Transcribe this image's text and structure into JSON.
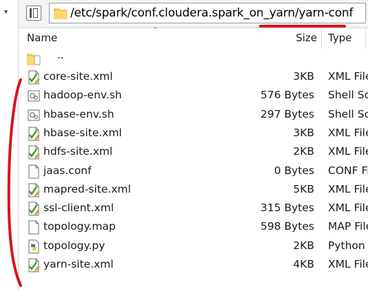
{
  "address_bar": {
    "path": "/etc/spark/conf.cloudera.spark_on_yarn/yarn-conf"
  },
  "columns": {
    "name": "Name",
    "size": "Size",
    "type": "Type"
  },
  "parent_entry": {
    "label": ".."
  },
  "files": [
    {
      "name": "core-site.xml",
      "size": "3KB",
      "type": "XML File",
      "icon": "xml-file-icon"
    },
    {
      "name": "hadoop-env.sh",
      "size": "576 Bytes",
      "type": "Shell Script",
      "icon": "shell-script-icon"
    },
    {
      "name": "hbase-env.sh",
      "size": "297 Bytes",
      "type": "Shell Script",
      "icon": "shell-script-icon"
    },
    {
      "name": "hbase-site.xml",
      "size": "3KB",
      "type": "XML File",
      "icon": "xml-file-icon"
    },
    {
      "name": "hdfs-site.xml",
      "size": "2KB",
      "type": "XML File",
      "icon": "xml-file-icon"
    },
    {
      "name": "jaas.conf",
      "size": "0 Bytes",
      "type": "CONF File",
      "icon": "blank-file-icon"
    },
    {
      "name": "mapred-site.xml",
      "size": "5KB",
      "type": "XML File",
      "icon": "xml-file-icon"
    },
    {
      "name": "ssl-client.xml",
      "size": "315 Bytes",
      "type": "XML File",
      "icon": "xml-file-icon"
    },
    {
      "name": "topology.map",
      "size": "598 Bytes",
      "type": "MAP File",
      "icon": "blank-file-icon"
    },
    {
      "name": "topology.py",
      "size": "2KB",
      "type": "Python File",
      "icon": "python-file-icon"
    },
    {
      "name": "yarn-site.xml",
      "size": "4KB",
      "type": "XML File",
      "icon": "xml-file-icon"
    }
  ],
  "annotation_color": "#d8141c"
}
